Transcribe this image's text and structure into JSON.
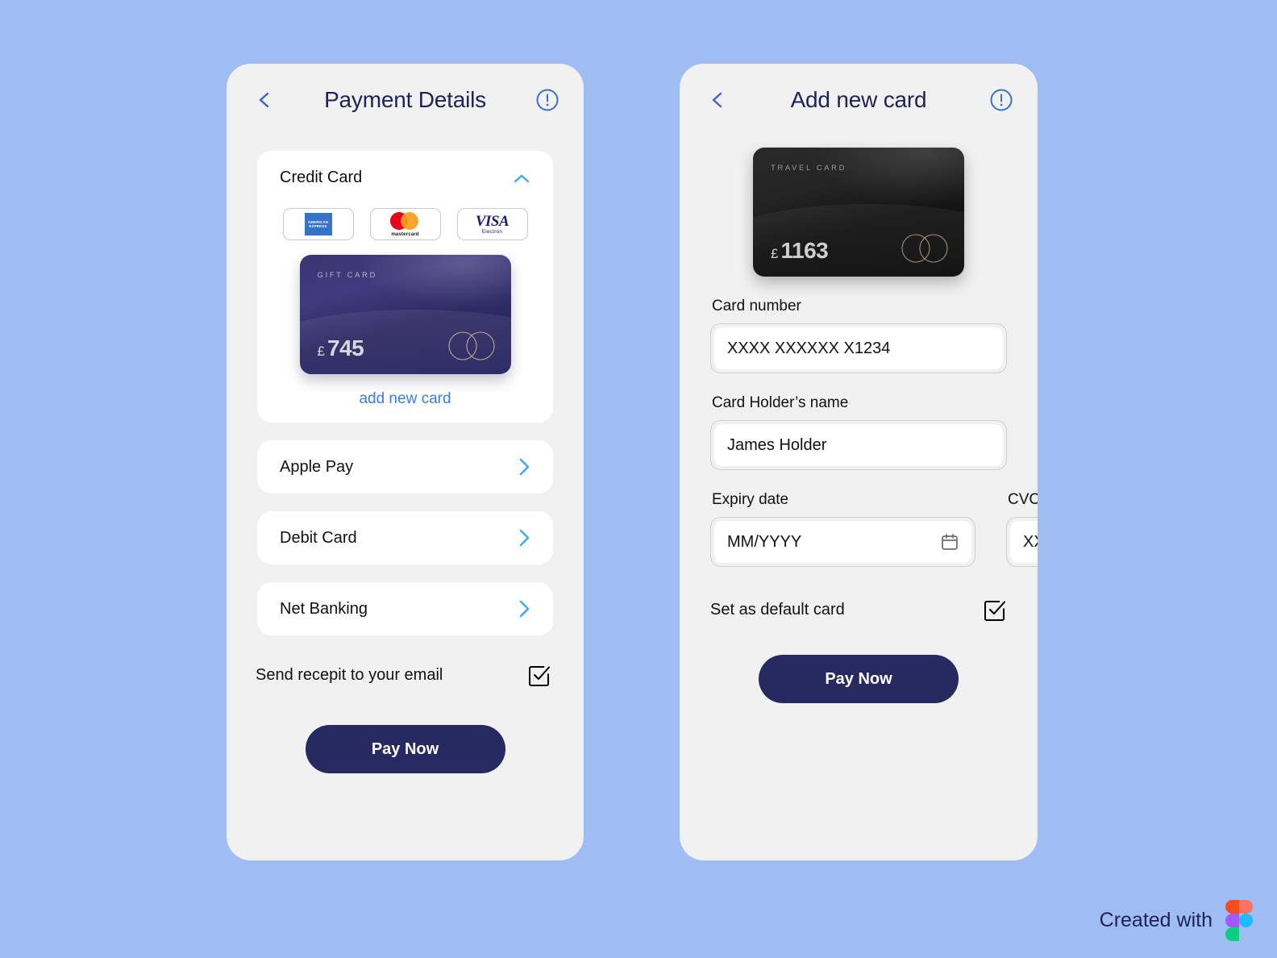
{
  "canvas": {
    "background_color": "#9FBDF3",
    "panel_color": "#F1F1F1",
    "accent_blue": "#3E7DD8",
    "chevron_blue": "#3FA9F5",
    "navy": "#262A60"
  },
  "left_screen": {
    "back_icon": "chevron-left-icon",
    "title": "Payment Details",
    "info_icon": "exclamation-circle-icon",
    "credit_card_section": {
      "title": "Credit Card",
      "collapse_icon": "chevron-up-icon",
      "brands": [
        {
          "name": "american-express",
          "label": "AMERICAN EXPRESS",
          "line1": "AMERICAN",
          "line2": "EXPRESS"
        },
        {
          "name": "mastercard",
          "label": "mastercard"
        },
        {
          "name": "visa-electron",
          "label": "VISA",
          "sublabel": "Electron"
        }
      ],
      "saved_card": {
        "kind": "GIFT CARD",
        "currency": "£",
        "amount": "745",
        "logo": "two-interlocking-circles-icon"
      },
      "add_new_card_label": "add new card"
    },
    "payment_rows": [
      {
        "label": "Apple Pay",
        "chevron": "chevron-right-icon"
      },
      {
        "label": "Debit Card",
        "chevron": "chevron-right-icon"
      },
      {
        "label": "Net Banking",
        "chevron": "chevron-right-icon"
      }
    ],
    "receipt": {
      "label": "Send recepit to your email",
      "checkbox_icon": "checkbox-checked-icon",
      "checked": true
    },
    "pay_now_label": "Pay Now"
  },
  "right_screen": {
    "back_icon": "chevron-left-icon",
    "title": "Add new card",
    "info_icon": "exclamation-circle-icon",
    "preview_card": {
      "kind": "TRAVEL CARD",
      "currency": "£",
      "amount": "1163",
      "logo": "two-interlocking-circles-icon"
    },
    "fields": {
      "card_number": {
        "label": "Card number",
        "value": "XXXX XXXXXX X1234",
        "placeholder": "XXXX XXXXXX X1234"
      },
      "card_holder": {
        "label": "Card Holder’s name",
        "value": "James Holder",
        "placeholder": "Card Holder’s name"
      },
      "expiry": {
        "label": "Expiry date",
        "value": "MM/YYYY",
        "placeholder": "MM/YYYY",
        "icon": "calendar-icon"
      },
      "cvc": {
        "label": "CVC/CVV",
        "value": "XXX",
        "placeholder": "XXX"
      }
    },
    "default_card": {
      "label": "Set as default card",
      "checkbox_icon": "checkbox-checked-icon",
      "checked": true
    },
    "pay_now_label": "Pay Now"
  },
  "watermark": {
    "text": "Created with",
    "logo": "figma-logo"
  }
}
